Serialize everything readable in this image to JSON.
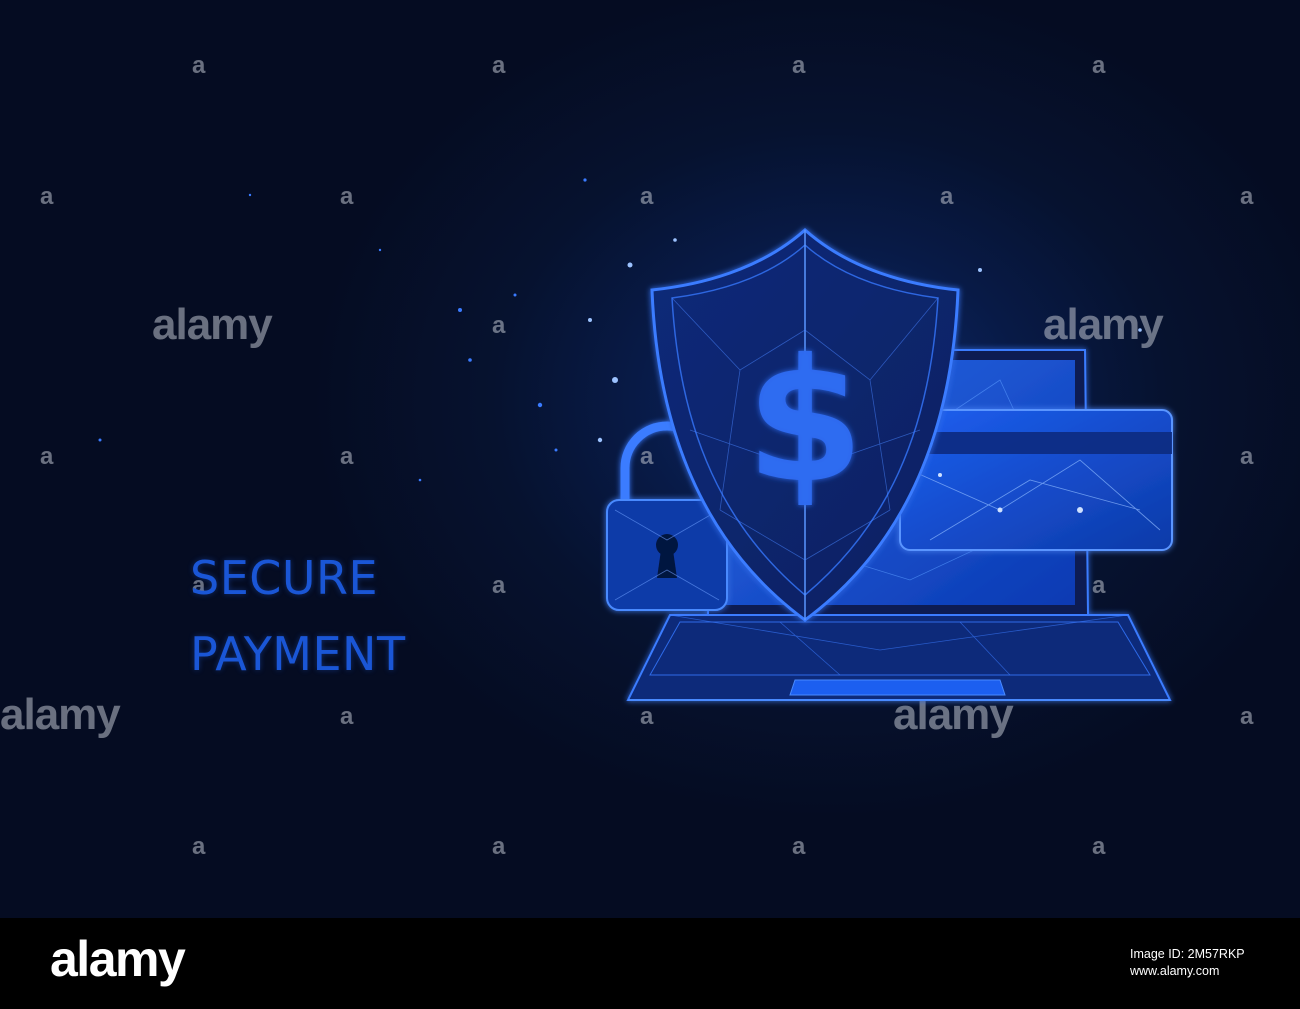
{
  "headline": {
    "line1": "SECURE",
    "line2": "PAYMENT"
  },
  "watermark": {
    "word": "alamy",
    "small": "a"
  },
  "footer": {
    "logo": "alamy",
    "image_id": "Image ID: 2M57RKP",
    "url": "www.alamy.com"
  },
  "colors": {
    "background": "#06122f",
    "accent": "#1a56d6",
    "glow": "#3a7bff"
  },
  "icons": [
    "shield-icon",
    "dollar-icon",
    "padlock-icon",
    "laptop-icon",
    "credit-card-icon"
  ]
}
